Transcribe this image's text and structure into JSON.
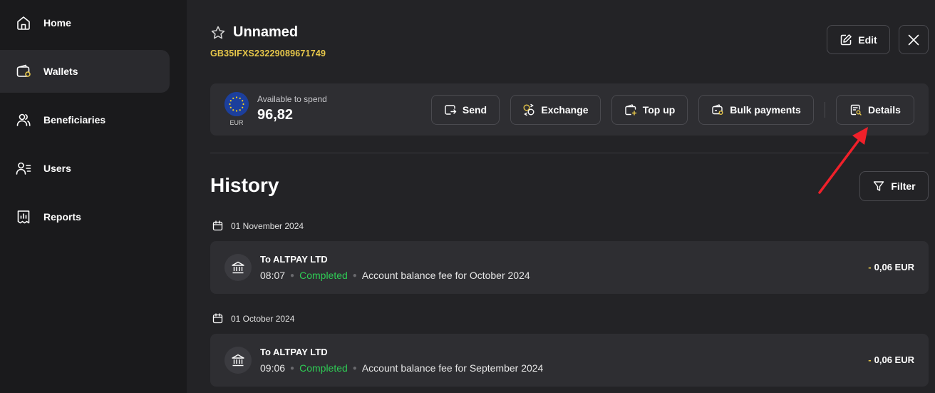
{
  "sidebar": {
    "items": [
      {
        "label": "Home",
        "icon": "home-icon",
        "active": false
      },
      {
        "label": "Wallets",
        "icon": "wallet-icon",
        "active": true
      },
      {
        "label": "Beneficiaries",
        "icon": "users-icon",
        "active": false
      },
      {
        "label": "Users",
        "icon": "user-list-icon",
        "active": false
      },
      {
        "label": "Reports",
        "icon": "reports-icon",
        "active": false
      }
    ]
  },
  "wallet": {
    "title": "Unnamed",
    "iban": "GB35IFXS23229089671749",
    "edit_label": "Edit"
  },
  "balance": {
    "currency": "EUR",
    "available_label": "Available to spend",
    "amount": "96,82"
  },
  "actions": {
    "send": "Send",
    "exchange": "Exchange",
    "top_up": "Top up",
    "bulk_payments": "Bulk payments",
    "details": "Details"
  },
  "history": {
    "title": "History",
    "filter_label": "Filter",
    "groups": [
      {
        "date": "01 November 2024",
        "transactions": [
          {
            "name": "To ALTPAY LTD",
            "time": "08:07",
            "status": "Completed",
            "description": "Account balance fee for October 2024",
            "sign": "-",
            "amount": "0,06 EUR"
          }
        ]
      },
      {
        "date": "01 October 2024",
        "transactions": [
          {
            "name": "To ALTPAY LTD",
            "time": "09:06",
            "status": "Completed",
            "description": "Account balance fee for September 2024",
            "sign": "-",
            "amount": "0,06 EUR"
          }
        ]
      }
    ]
  },
  "colors": {
    "accent_yellow": "#e8c84a",
    "status_green": "#2ecc55",
    "annotation_red": "#f0202a"
  }
}
